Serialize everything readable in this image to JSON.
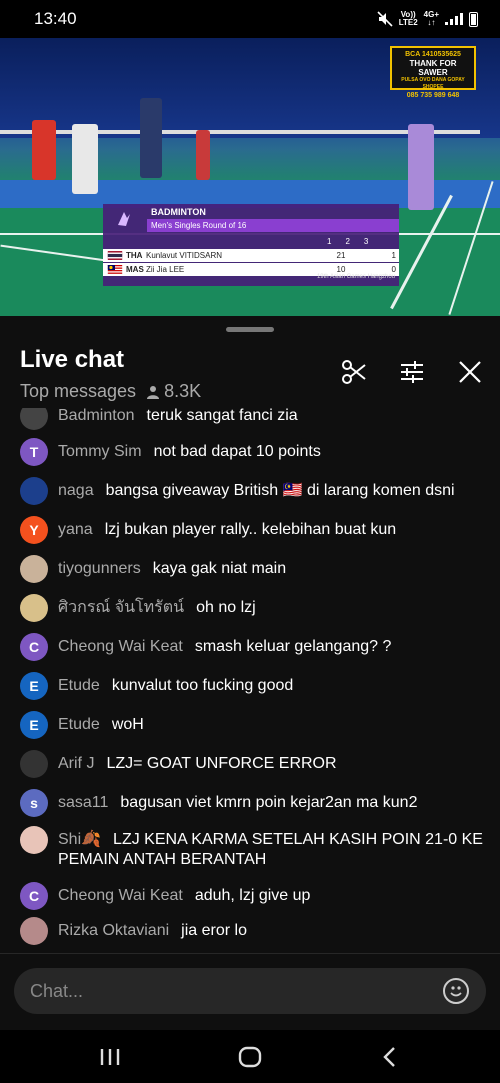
{
  "status_bar": {
    "time": "13:40",
    "network_top": "Vo))",
    "network_bottom": "LTE2",
    "network_type": "4G+"
  },
  "video": {
    "sponsor_line1": "BCA 1410535625",
    "sponsor_line2": "THANK FOR SAWER",
    "sponsor_line3": "PULSA OVO DANA GOPAY SHOPEE",
    "sponsor_line4": "085 735 989 648",
    "scoreboard": {
      "sport": "BADMINTON",
      "event": "Men's Singles Round of 16",
      "set_headers": [
        "1",
        "2",
        "3"
      ],
      "players": [
        {
          "country": "THA",
          "name": "Kunlavut VITIDSARN",
          "set1": "21",
          "set2": "1"
        },
        {
          "country": "MAS",
          "name": "Zii Jia LEE",
          "set1": "10",
          "set2": "0"
        }
      ],
      "footer": "19th Asian Games Hangzhou"
    }
  },
  "chat": {
    "title": "Live chat",
    "mode": "Top messages",
    "viewer_count": "8.3K",
    "input_placeholder": "Chat...",
    "messages": [
      {
        "author": "Badminton",
        "text": "teruk sangat fanci zia",
        "initial": "",
        "avatar_color": "#444"
      },
      {
        "author": "Tommy Sim",
        "text": "not bad dapat 10 points",
        "initial": "T",
        "avatar_color": "#7e57c2"
      },
      {
        "author": "naga",
        "text": "bangsa giveaway British 🇲🇾 di larang komen dsni",
        "initial": "",
        "avatar_color": "#1c3f8c"
      },
      {
        "author": "yana",
        "text": "lzj bukan player rally.. kelebihan buat kun",
        "initial": "Y",
        "avatar_color": "#f4511e"
      },
      {
        "author": "tiyogunners",
        "text": "kaya gak niat main",
        "initial": "",
        "avatar_color": "#c9b29a"
      },
      {
        "author": "ศิวกรณ์ จันโทรัตน์",
        "text": "oh no lzj",
        "initial": "",
        "avatar_color": "#d8c08a"
      },
      {
        "author": "Cheong Wai Keat",
        "text": "smash keluar gelangang? ?",
        "initial": "C",
        "avatar_color": "#7e57c2"
      },
      {
        "author": "Etude",
        "text": "kunvalut too fucking good",
        "initial": "E",
        "avatar_color": "#1565c0"
      },
      {
        "author": "Etude",
        "text": "woH",
        "initial": "E",
        "avatar_color": "#1565c0"
      },
      {
        "author": "Arif J",
        "text": "LZJ= GOAT UNFORCE ERROR",
        "initial": "",
        "avatar_color": "#333"
      },
      {
        "author": "sasa11",
        "text": "bagusan viet kmrn poin kejar2an ma kun2",
        "initial": "s",
        "avatar_color": "#5c6bc0"
      },
      {
        "author": "Shi🍂",
        "text": "LZJ KENA KARMA SETELAH KASIH POIN 21-0 KE PEMAIN ANTAH BERANTAH",
        "initial": "",
        "avatar_color": "#e8c4b8"
      },
      {
        "author": "Cheong Wai Keat",
        "text": "aduh, lzj give up",
        "initial": "C",
        "avatar_color": "#7e57c2"
      },
      {
        "author": "Rizka Oktaviani",
        "text": "jia eror lo",
        "initial": "",
        "avatar_color": "#b58a8a"
      }
    ]
  },
  "icons": {
    "mute": "mute-icon",
    "signal": "signal-icon",
    "battery": "battery-icon",
    "clip": "scissors-icon",
    "filter": "sliders-icon",
    "close": "close-icon",
    "emoji": "emoji-icon",
    "recents": "recents-icon",
    "home": "home-icon",
    "back": "back-icon"
  }
}
